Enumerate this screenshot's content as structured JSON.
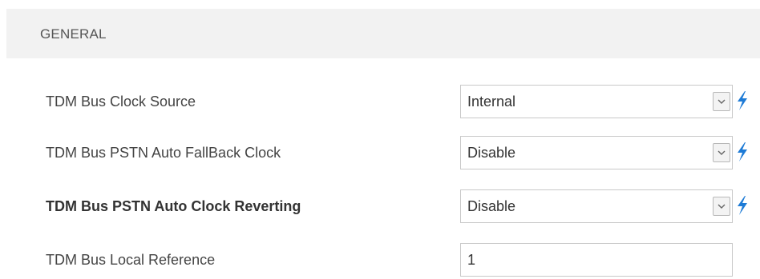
{
  "section": {
    "title": "GENERAL"
  },
  "accent_color": "#1e7bd6",
  "fields": [
    {
      "label": "TDM Bus Clock Source",
      "type": "select",
      "value": "Internal",
      "icon": "lightning-bolt-icon"
    },
    {
      "label": "TDM Bus PSTN Auto FallBack Clock",
      "type": "select",
      "value": "Disable",
      "icon": "lightning-bolt-icon"
    },
    {
      "label": "TDM Bus PSTN Auto Clock Reverting",
      "type": "select",
      "value": "Disable",
      "icon": "lightning-bolt-icon",
      "emphasized": true
    },
    {
      "label": "TDM Bus Local Reference",
      "type": "text",
      "value": "1"
    }
  ]
}
